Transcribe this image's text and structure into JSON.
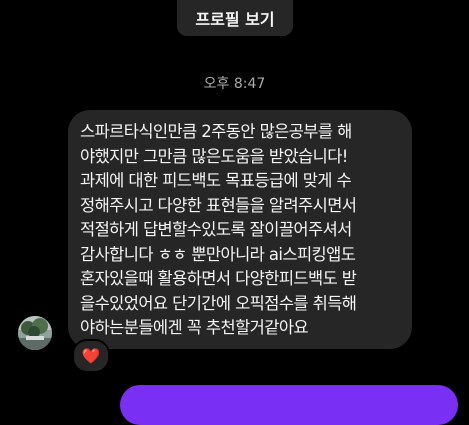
{
  "header": {
    "profile_button_label": "프로필 보기"
  },
  "thread": {
    "timestamp": "오후 8:47",
    "incoming_message": {
      "lines": [
        "스파르타식인만큼 2주동안 많은공부를 해",
        "야했지만 그만큼 많은도움을 받았습니다!",
        "과제에 대한 피드백도 목표등급에 맞게 수",
        "정해주시고 다양한 표현들을 알려주시면서",
        "적절하게 답변할수있도록 잘이끌어주셔서",
        "감사합니다 ㅎㅎ 뿐만아니라 ai스피킹앱도",
        "혼자있을때 활용하면서 다양한피드백도 받",
        "을수있었어요 단기간에 오픽점수를 취득해",
        "야하는분들에겐 꼭 추천할거같아요"
      ],
      "reaction": "❤️"
    }
  },
  "colors": {
    "background": "#000000",
    "bubble_incoming": "#262626",
    "bubble_outgoing": "#7a2ff5",
    "text_primary": "#f5f5f5",
    "text_secondary": "#a8a8a8"
  }
}
